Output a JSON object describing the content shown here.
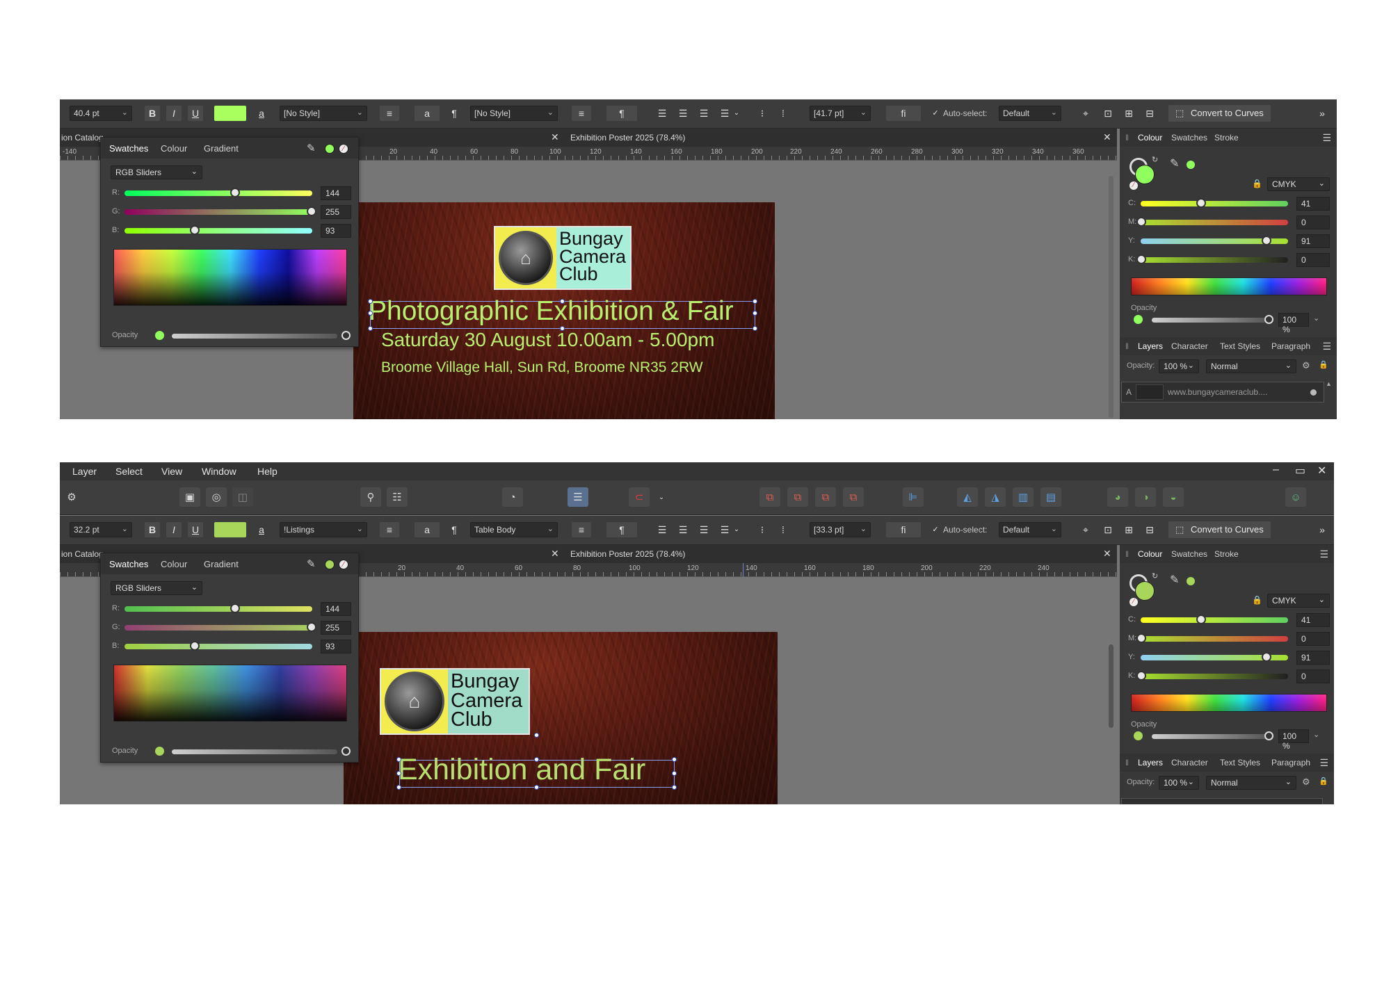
{
  "colors": {
    "accent_green": "#90ff5d",
    "fill_green_bottom": "#a8d65a",
    "poster_text": "#b8f070",
    "logo_yellow": "#f2ec4e",
    "logo_teal": "#a8eed8"
  },
  "shot1": {
    "font_size": "40.4 pt",
    "char_style": "[No Style]",
    "para_style": "[No Style]",
    "leading": "[41.7 pt]",
    "auto_select_label": "Auto-select:",
    "auto_select_value": "Default",
    "convert_label": "Convert to Curves",
    "cut_tab": "ion Catalog",
    "doc_tab": "Exhibition Poster 2025 (78.4%)",
    "ruler_ticks": [
      "-140",
      "20",
      "40",
      "60",
      "80",
      "100",
      "120",
      "140",
      "160",
      "180",
      "200",
      "220",
      "240",
      "260",
      "280",
      "300",
      "320",
      "340",
      "360"
    ],
    "poster": {
      "logo_lines": [
        "Bungay",
        "Camera",
        "Club"
      ],
      "headline": "Photographic Exhibition & Fair",
      "date_line": "Saturday 30 August 10.00am - 5.00pm",
      "venue_line": "Broome Village Hall, Sun Rd, Broome NR35 2RW"
    },
    "layer_name": "www.bungaycameraclub...."
  },
  "shot2": {
    "menu": [
      "Layer",
      "Select",
      "View",
      "Window",
      "Help"
    ],
    "font_size": "32.2 pt",
    "char_style": "!Listings",
    "para_style": "Table Body",
    "leading": "[33.3 pt]",
    "auto_select_label": "Auto-select:",
    "auto_select_value": "Default",
    "convert_label": "Convert to Curves",
    "cut_tab": "ion Catalog",
    "doc_tab": "Exhibition Poster 2025 (78.4%)",
    "ruler_ticks": [
      "20",
      "40",
      "60",
      "80",
      "100",
      "120",
      "140",
      "160",
      "180",
      "200",
      "220",
      "240"
    ],
    "poster": {
      "logo_lines": [
        "Bungay",
        "Camera",
        "Club"
      ],
      "headline": "Exhibition and Fair"
    }
  },
  "colour_panel": {
    "tabs": [
      "Swatches",
      "Colour",
      "Gradient"
    ],
    "mode": "RGB Sliders",
    "channels": [
      {
        "label": "R:",
        "value": "144",
        "fraction": 0.565
      },
      {
        "label": "G:",
        "value": "255",
        "fraction": 1.0
      },
      {
        "label": "B:",
        "value": "93",
        "fraction": 0.365
      }
    ],
    "opacity_label": "Opacity"
  },
  "right_panel": {
    "tabs": [
      "Colour",
      "Swatches",
      "Stroke"
    ],
    "model": "CMYK",
    "channels": [
      {
        "label": "C:",
        "value": "41",
        "fraction": 0.41
      },
      {
        "label": "M:",
        "value": "0",
        "fraction": 0.0
      },
      {
        "label": "Y:",
        "value": "91",
        "fraction": 0.91
      },
      {
        "label": "K:",
        "value": "0",
        "fraction": 0.0
      }
    ],
    "opacity_label": "Opacity",
    "opacity_value": "100 %",
    "layer_tabs": [
      "Layers",
      "Character",
      "Text Styles",
      "Paragraph"
    ],
    "layer_opacity_label": "Opacity:",
    "layer_opacity_value": "100 %",
    "blend_mode": "Normal"
  }
}
